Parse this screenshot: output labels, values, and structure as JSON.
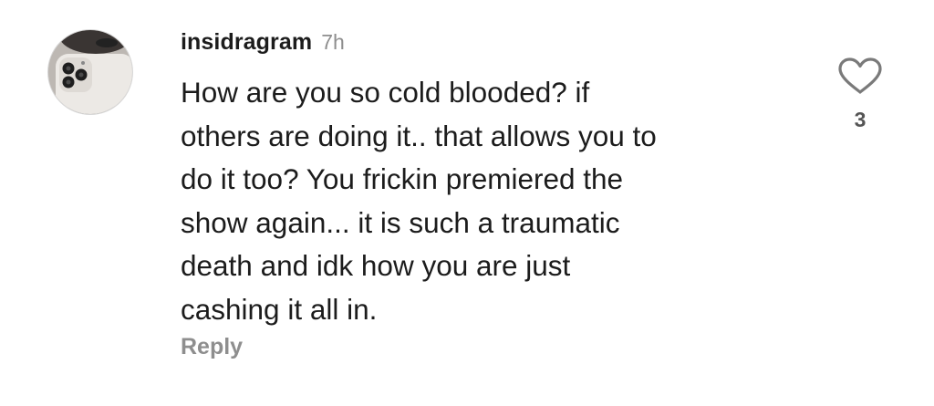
{
  "comment": {
    "username": "insidragram",
    "time": "7h",
    "body_lines": [
      "How are you so cold blooded? if",
      "others are doing it.. that allows you to",
      "do it too? You frickin premiered the",
      "show again... it is such a traumatic",
      "death and idk how you are just",
      "cashing it all in."
    ],
    "reply_label": "Reply",
    "like_icon": "heart-outline-icon",
    "like_count": "3"
  },
  "colors": {
    "text": "#1c1c1c",
    "muted": "#8e8e8e",
    "background": "#ffffff"
  }
}
